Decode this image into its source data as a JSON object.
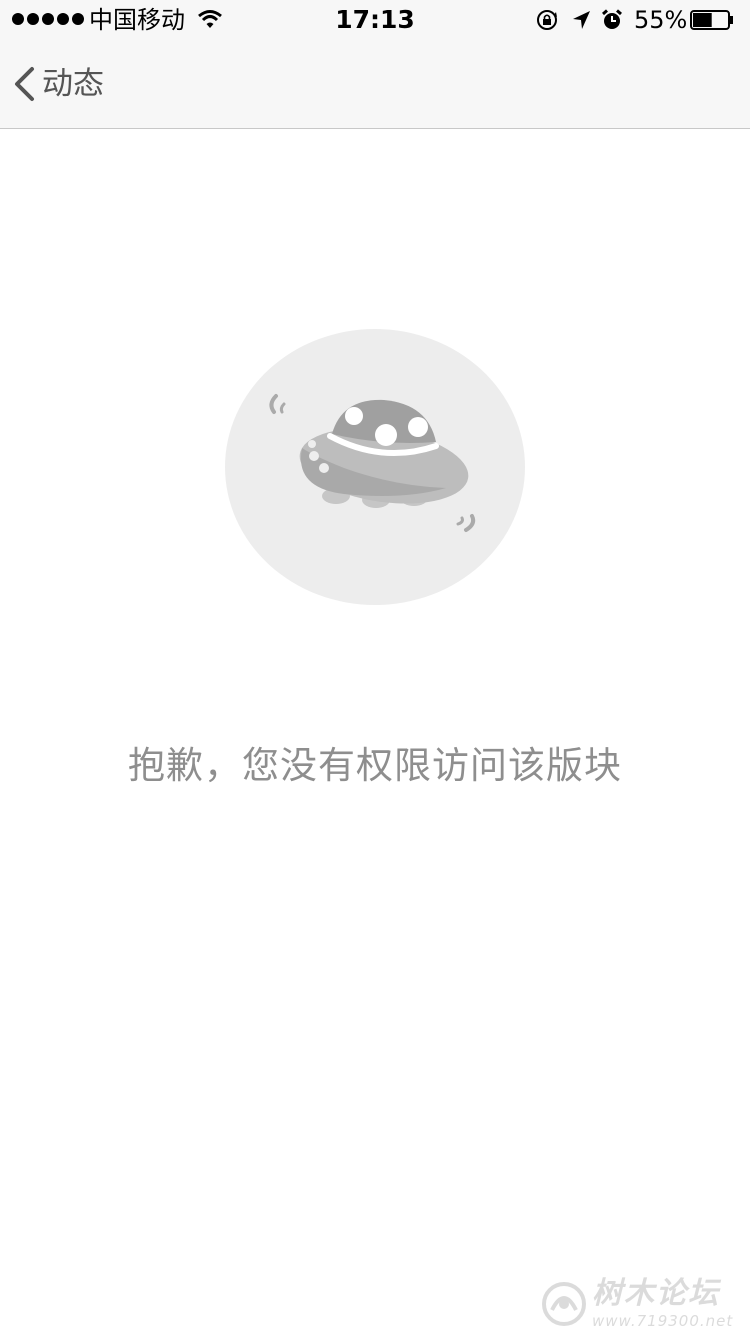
{
  "status_bar": {
    "carrier": "中国移动",
    "time": "17:13",
    "battery_percent": "55%",
    "battery_level": 0.55,
    "icons": [
      "signal-dots-icon",
      "wifi-icon",
      "rotation-lock-icon",
      "location-arrow-icon",
      "alarm-clock-icon",
      "battery-icon"
    ]
  },
  "nav": {
    "back_label": "动态",
    "back_icon": "chevron-left-icon"
  },
  "empty_state": {
    "illustration": "ufo-icon",
    "message": "抱歉，您没有权限访问该版块"
  },
  "watermark": {
    "text": "树木论坛",
    "url": "www.719300.net"
  }
}
